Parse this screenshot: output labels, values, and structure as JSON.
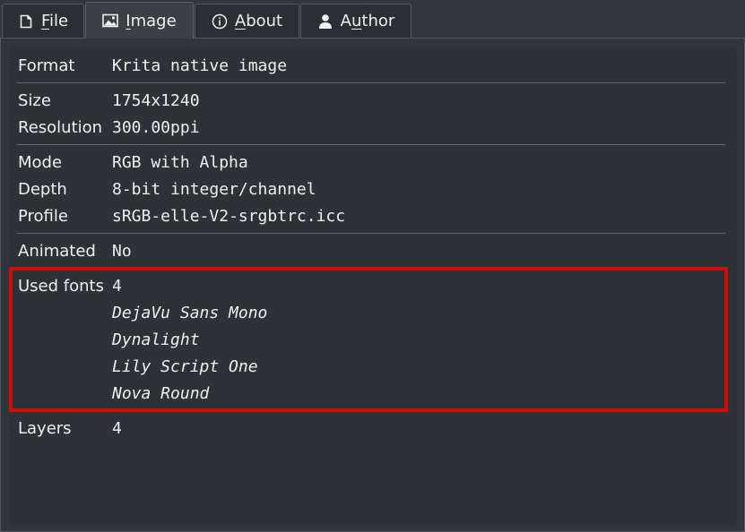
{
  "tabs": [
    {
      "label_pre": "",
      "label_ul": "F",
      "label_post": "ile",
      "icon": "file-icon",
      "active": false
    },
    {
      "label_pre": "",
      "label_ul": "I",
      "label_post": "mage",
      "icon": "image-icon",
      "active": true
    },
    {
      "label_pre": "",
      "label_ul": "A",
      "label_post": "bout",
      "icon": "info-icon",
      "active": false
    },
    {
      "label_pre": "A",
      "label_ul": "u",
      "label_post": "thor",
      "icon": "user-icon",
      "active": false
    }
  ],
  "properties": {
    "format": {
      "label": "Format",
      "value": "Krita native image"
    },
    "size": {
      "label": "Size",
      "value": "1754x1240"
    },
    "resolution": {
      "label": "Resolution",
      "value": "300.00ppi"
    },
    "mode": {
      "label": "Mode",
      "value": "RGB with Alpha"
    },
    "depth": {
      "label": "Depth",
      "value": "8-bit integer/channel"
    },
    "profile": {
      "label": "Profile",
      "value": "sRGB-elle-V2-srgbtrc.icc"
    },
    "animated": {
      "label": "Animated",
      "value": "No"
    },
    "used_fonts": {
      "label": "Used fonts",
      "count": "4",
      "fonts": [
        "DejaVu Sans Mono",
        "Dynalight",
        "Lily Script One",
        "Nova Round"
      ]
    },
    "layers": {
      "label": "Layers",
      "value": "4"
    }
  },
  "colors": {
    "background": "#31363b",
    "text": "#eff0f1",
    "highlight_border": "#d10a0a",
    "separator": "#62676c"
  }
}
